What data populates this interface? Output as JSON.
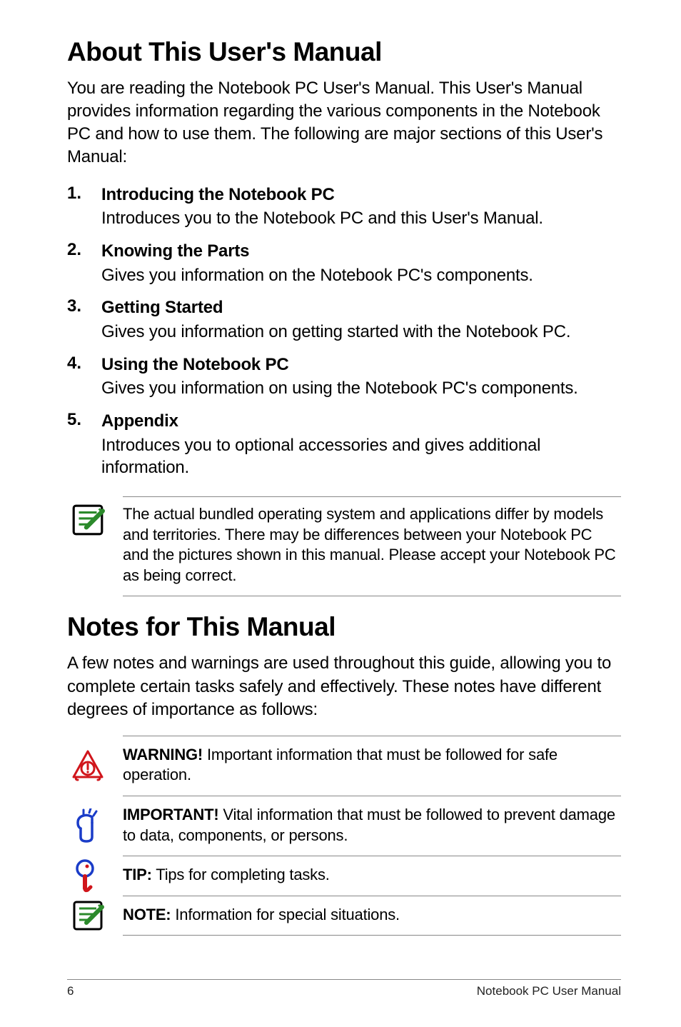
{
  "heading1": "About This User's Manual",
  "intro": "You are reading the Notebook PC User's Manual. This User's Manual provides information regarding the various components in the Notebook PC and how to use them. The following are major sections of this User's Manual:",
  "sections": [
    {
      "title": "Introducing the Notebook PC",
      "desc": "Introduces you to the Notebook PC and this User's Manual."
    },
    {
      "title": "Knowing the Parts",
      "desc": "Gives you information on the Notebook PC's components."
    },
    {
      "title": "Getting Started",
      "desc": "Gives you information on getting started with the Notebook PC."
    },
    {
      "title": "Using the Notebook PC",
      "desc": "Gives you information on using the Notebook PC's components."
    },
    {
      "title": "Appendix",
      "desc": "Introduces you to optional accessories and gives additional information."
    }
  ],
  "note_block": "The actual bundled operating system and applications differ by models and territories. There may be differences between your Notebook PC and the pictures shown in this manual. Please accept your Notebook PC as being correct.",
  "heading2": "Notes for This Manual",
  "notes_intro": "A few notes and warnings are used throughout this guide, allowing you to complete certain tasks safely and effectively. These notes have different degrees of importance as follows:",
  "callouts": [
    {
      "icon": "warning-icon",
      "label": "WARNING!",
      "text": " Important information that must be followed for safe operation."
    },
    {
      "icon": "important-icon",
      "label": "IMPORTANT!",
      "text": " Vital information that must be followed to prevent damage to data, components, or persons."
    },
    {
      "icon": "tip-icon",
      "label": "TIP:",
      "text": " Tips for completing tasks."
    },
    {
      "icon": "note-icon",
      "label": "NOTE:",
      "text": "  Information for special situations."
    }
  ],
  "footer": {
    "page": "6",
    "title": "Notebook PC User Manual"
  }
}
